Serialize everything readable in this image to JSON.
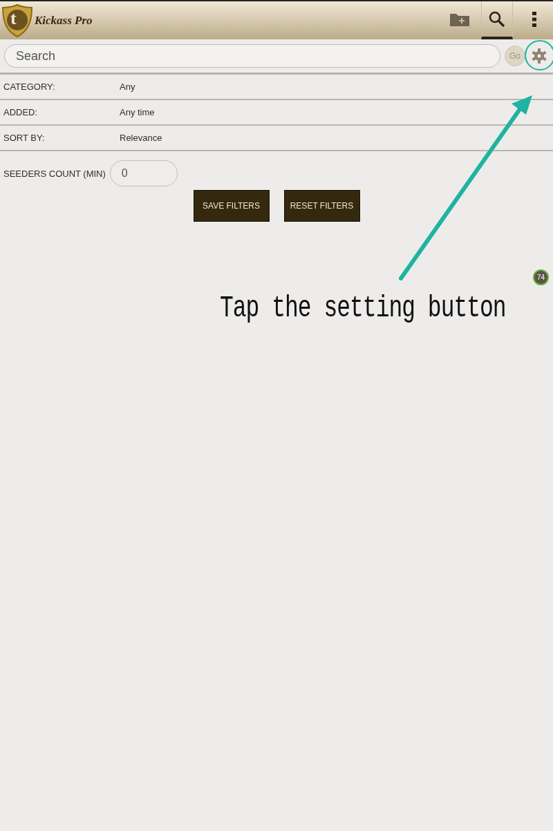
{
  "app_bar": {
    "title": "Kickass Pro",
    "logo_letter": "t",
    "actions": [
      {
        "kind": "folder",
        "selected": false
      },
      {
        "kind": "search",
        "selected": true
      },
      {
        "kind": "menu",
        "selected": false
      }
    ]
  },
  "search": {
    "placeholder": "Search",
    "go_label": "Go"
  },
  "filters": [
    {
      "label": "CATEGORY:",
      "value": "Any"
    },
    {
      "label": "ADDED:",
      "value": "Any time"
    },
    {
      "label": "SORT BY:",
      "value": "Relevance"
    }
  ],
  "seeders": {
    "label": "SEEDERS COUNT (MIN)",
    "value": "0"
  },
  "buttons": [
    "SAVE FILTERS",
    "RESET FILTERS"
  ],
  "floating_badge": "74",
  "annotation": "Tap the setting button"
}
